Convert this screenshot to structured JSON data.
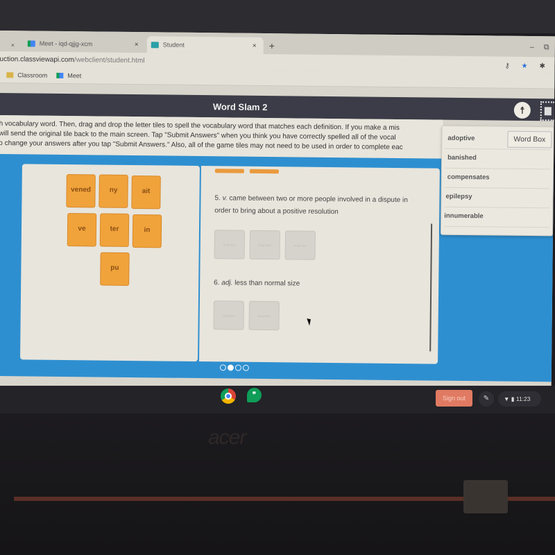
{
  "browser": {
    "tabs": [
      {
        "label": "Meet - iqd-qjjg-xcm",
        "icon": "google-meet-icon",
        "active": false
      },
      {
        "label": "Student",
        "icon": "classroom-app-icon",
        "active": true
      }
    ],
    "new_tab": "+",
    "close_glyph": "×",
    "url_host": "uction.classviewapi.com",
    "url_path": "/webclient/student.html",
    "bookmarks": [
      {
        "label": "Classroom",
        "icon": "classroom-icon"
      },
      {
        "label": "Meet",
        "icon": "google-meet-icon"
      }
    ],
    "window_controls": {
      "minimize": "–",
      "restore": "⧉"
    },
    "toolbar_icons": {
      "key": "⚷",
      "star": "★",
      "extensions": "✱"
    }
  },
  "app": {
    "title": "Word Slam 2",
    "accessibility_glyph": "☨",
    "instructions": [
      "h vocabulary word. Then, drag and drop the letter tiles to spell the vocabulary word that matches each definition. If you make a mis",
      "will send the original tile back to the main screen. Tap \"Submit Answers\" when you think you have correctly spelled all of the vocal",
      "o change your answers after you tap \"Submit Answers.\" Also, all of the game tiles may not need to be used in order to complete eac"
    ],
    "tiles": [
      "vened",
      "ny",
      "ait",
      "ve",
      "ter",
      "in",
      "pu"
    ],
    "questions": [
      {
        "number": "5.",
        "pos": "v.",
        "definition": "came between two or more people involved in a dispute in order to bring about a positive resolution",
        "slots": 3
      },
      {
        "number": "6.",
        "pos": "adj.",
        "definition": "less than normal size",
        "slots": 2
      }
    ],
    "slot_placeholder": "Drop Here",
    "pager": {
      "total": 4,
      "current": 2
    },
    "word_box": {
      "button_label": "Word Box",
      "words": [
        "adoptive",
        "banished",
        "compensates",
        "epilepsy",
        "innumerable"
      ]
    }
  },
  "shelf": {
    "apps": [
      {
        "name": "Chrome",
        "icon": "chrome-icon"
      },
      {
        "name": "Hangouts",
        "icon": "hangouts-icon",
        "glyph": "❞"
      }
    ],
    "sign_out_label": "Sign out",
    "pen_glyph": "✎",
    "status": {
      "wifi": "▼",
      "battery": "▮",
      "time": "11:23"
    }
  },
  "device": {
    "brand": "acer"
  },
  "colors": {
    "header_bg": "#3b3c47",
    "game_bg": "#2e8fd0",
    "tile": "#f0a33b",
    "sign_out": "#e07a62"
  }
}
